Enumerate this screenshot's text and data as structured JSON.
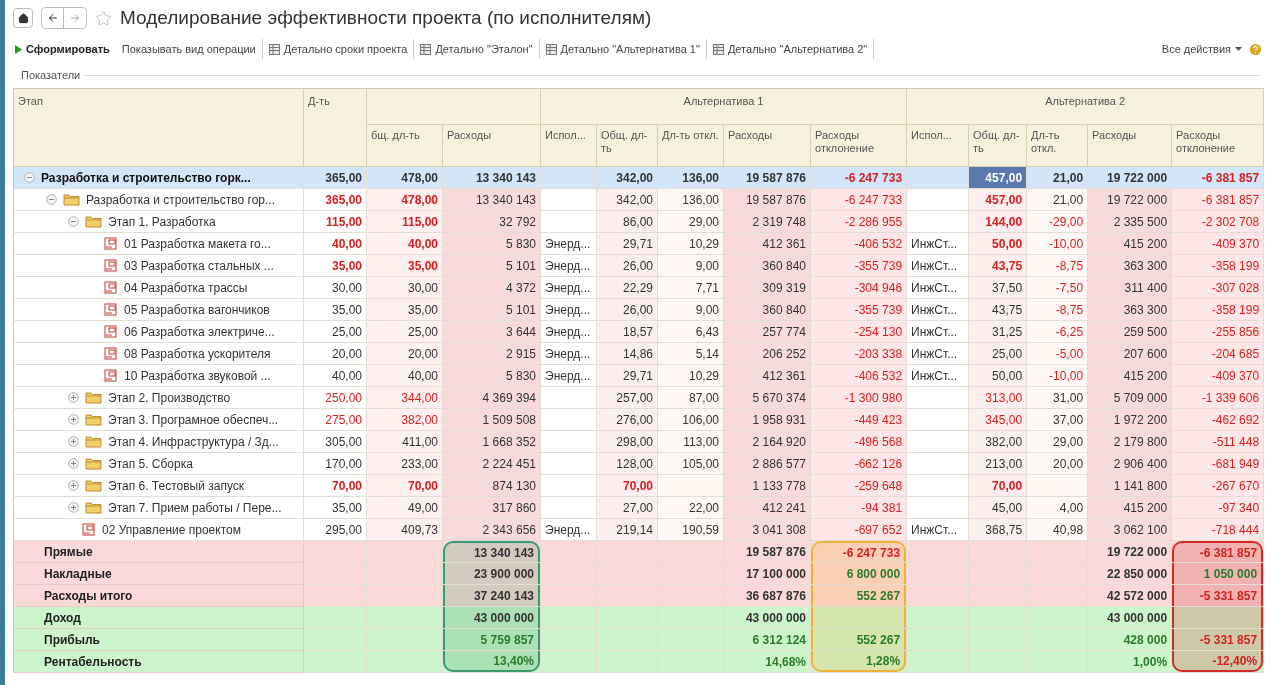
{
  "window": {
    "title": "Моделирование эффективности проекта (по исполнителям)"
  },
  "toolbar": [
    {
      "label": "Сформировать",
      "kind": "run"
    },
    {
      "label": "Показывать вид операции",
      "kind": "plain"
    },
    {
      "label": "Детально сроки проекта",
      "kind": "report"
    },
    {
      "label": "Детально \"Эталон\"",
      "kind": "report"
    },
    {
      "label": "Детально \"Альтернатива 1\"",
      "kind": "report"
    },
    {
      "label": "Детально \"Альтернатива 2\"",
      "kind": "report"
    },
    {
      "label": "Все действия",
      "kind": "menu"
    }
  ],
  "section": {
    "title": "Показатели"
  },
  "header": {
    "stage": "Этап",
    "duration": "Д-ть",
    "groups": [
      {
        "columns": [
          "бщ. дл-ть",
          "Расходы"
        ]
      },
      {
        "label": "Альтернатива 1",
        "columns": [
          "Испол...",
          "Общ. дл-ть",
          "Дл-ть откл.",
          "Расходы",
          "Расходы отклонение"
        ]
      },
      {
        "label": "Альтернатива 2",
        "columns": [
          "Испол...",
          "Общ. дл-ть",
          "Дл-ть откл.",
          "Расходы",
          "Расходы отклонение"
        ]
      }
    ]
  },
  "tree": [
    {
      "label": "Разработка и строительство горк...",
      "kind": "total",
      "expanded": true,
      "selected": true,
      "cells": [
        "365,00",
        "478,00",
        "13 340 143",
        null,
        "342,00",
        "136,00",
        "19 587 876",
        {
          "text": "-6 247 733",
          "red": true
        },
        null,
        {
          "text": "457,00",
          "current": true
        },
        "21,00",
        "19 722 000",
        {
          "text": "-6 381 857",
          "red": true
        }
      ],
      "children": [
        {
          "label": "Разработка и строительство гор...",
          "kind": "group",
          "expanded": true,
          "selected": false,
          "cells": [
            {
              "text": "365,00",
              "red": true,
              "bold": true
            },
            {
              "text": "478,00",
              "red": true,
              "bold": true
            },
            "13 340 143",
            null,
            "342,00",
            "136,00",
            "19 587 876",
            {
              "text": "-6 247 733",
              "red": true
            },
            null,
            {
              "text": "457,00",
              "red": true,
              "bold": true
            },
            "21,00",
            "19 722 000",
            {
              "text": "-6 381 857",
              "red": true
            }
          ],
          "children": [
            {
              "label": "Этап 1. Разработка",
              "kind": "group",
              "expanded": true,
              "selected": false,
              "cells": [
                {
                  "text": "115,00",
                  "red": true,
                  "bold": true
                },
                {
                  "text": "115,00",
                  "red": true,
                  "bold": true
                },
                "32 792",
                null,
                "86,00",
                "29,00",
                "2 319 748",
                {
                  "text": "-2 286 955",
                  "red": true
                },
                null,
                {
                  "text": "144,00",
                  "red": true,
                  "bold": true
                },
                {
                  "text": "-29,00",
                  "red": true
                },
                "2 335 500",
                {
                  "text": "-2 302 708",
                  "red": true
                }
              ],
              "children": [
                {
                  "label": "01 Разработка макета го...",
                  "kind": "task",
                  "selected": false,
                  "cells": [
                    {
                      "text": "40,00",
                      "red": true,
                      "bold": true
                    },
                    {
                      "text": "40,00",
                      "red": true,
                      "bold": true
                    },
                    "5 830",
                    "Энерд...",
                    "29,71",
                    "10,29",
                    "412 361",
                    {
                      "text": "-406 532",
                      "red": true
                    },
                    "ИнжСт...",
                    {
                      "text": "50,00",
                      "red": true,
                      "bold": true
                    },
                    {
                      "text": "-10,00",
                      "red": true
                    },
                    "415 200",
                    {
                      "text": "-409 370",
                      "red": true
                    }
                  ]
                },
                {
                  "label": "03 Разработка стальных ...",
                  "kind": "task",
                  "selected": false,
                  "cells": [
                    {
                      "text": "35,00",
                      "red": true,
                      "bold": true
                    },
                    {
                      "text": "35,00",
                      "red": true,
                      "bold": true
                    },
                    "5 101",
                    "Энерд...",
                    "26,00",
                    "9,00",
                    "360 840",
                    {
                      "text": "-355 739",
                      "red": true
                    },
                    "ИнжСт...",
                    {
                      "text": "43,75",
                      "red": true,
                      "bold": true
                    },
                    {
                      "text": "-8,75",
                      "red": true
                    },
                    "363 300",
                    {
                      "text": "-358 199",
                      "red": true
                    }
                  ]
                },
                {
                  "label": "04 Разработка трассы",
                  "kind": "task",
                  "selected": false,
                  "cells": [
                    "30,00",
                    "30,00",
                    "4 372",
                    "Энерд...",
                    "22,29",
                    "7,71",
                    "309 319",
                    {
                      "text": "-304 946",
                      "red": true
                    },
                    "ИнжСт...",
                    "37,50",
                    {
                      "text": "-7,50",
                      "red": true
                    },
                    "311 400",
                    {
                      "text": "-307 028",
                      "red": true
                    }
                  ]
                },
                {
                  "label": "05 Разработка вагончиков",
                  "kind": "task",
                  "selected": false,
                  "cells": [
                    "35,00",
                    "35,00",
                    "5 101",
                    "Энерд...",
                    "26,00",
                    "9,00",
                    "360 840",
                    {
                      "text": "-355 739",
                      "red": true
                    },
                    "ИнжСт...",
                    "43,75",
                    {
                      "text": "-8,75",
                      "red": true
                    },
                    "363 300",
                    {
                      "text": "-358 199",
                      "red": true
                    }
                  ]
                },
                {
                  "label": "06 Разработка электриче...",
                  "kind": "task",
                  "selected": false,
                  "cells": [
                    "25,00",
                    "25,00",
                    "3 644",
                    "Энерд...",
                    "18,57",
                    "6,43",
                    "257 774",
                    {
                      "text": "-254 130",
                      "red": true
                    },
                    "ИнжСт...",
                    "31,25",
                    {
                      "text": "-6,25",
                      "red": true
                    },
                    "259 500",
                    {
                      "text": "-255 856",
                      "red": true
                    }
                  ]
                },
                {
                  "label": "08 Разработка ускорителя",
                  "kind": "task",
                  "selected": false,
                  "cells": [
                    "20,00",
                    "20,00",
                    "2 915",
                    "Энерд...",
                    "14,86",
                    "5,14",
                    "206 252",
                    {
                      "text": "-203 338",
                      "red": true
                    },
                    "ИнжСт...",
                    "25,00",
                    {
                      "text": "-5,00",
                      "red": true
                    },
                    "207 600",
                    {
                      "text": "-204 685",
                      "red": true
                    }
                  ]
                },
                {
                  "label": "10 Разработка звуковой ...",
                  "kind": "task",
                  "selected": false,
                  "cells": [
                    "40,00",
                    "40,00",
                    "5 830",
                    "Энерд...",
                    "29,71",
                    "10,29",
                    "412 361",
                    {
                      "text": "-406 532",
                      "red": true
                    },
                    "ИнжСт...",
                    "50,00",
                    {
                      "text": "-10,00",
                      "red": true
                    },
                    "415 200",
                    {
                      "text": "-409 370",
                      "red": true
                    }
                  ]
                }
              ]
            },
            {
              "label": "Этап 2. Производство",
              "kind": "group",
              "expanded": false,
              "selected": false,
              "cells": [
                {
                  "text": "250,00",
                  "red": true
                },
                {
                  "text": "344,00",
                  "red": true
                },
                "4 369 394",
                null,
                "257,00",
                "87,00",
                "5 670 374",
                {
                  "text": "-1 300 980",
                  "red": true
                },
                null,
                {
                  "text": "313,00",
                  "red": true
                },
                "31,00",
                "5 709 000",
                {
                  "text": "-1 339 606",
                  "red": true
                }
              ]
            },
            {
              "label": "Этап 3. Програмное обеспеч...",
              "kind": "group",
              "expanded": false,
              "selected": false,
              "cells": [
                {
                  "text": "275,00",
                  "red": true
                },
                {
                  "text": "382,00",
                  "red": true
                },
                "1 509 508",
                null,
                "276,00",
                "106,00",
                "1 958 931",
                {
                  "text": "-449 423",
                  "red": true
                },
                null,
                {
                  "text": "345,00",
                  "red": true
                },
                "37,00",
                "1 972 200",
                {
                  "text": "-462 692",
                  "red": true
                }
              ]
            },
            {
              "label": "Этап 4. Инфраструктура / Зд...",
              "kind": "group",
              "expanded": false,
              "selected": false,
              "cells": [
                "305,00",
                "411,00",
                "1 668 352",
                null,
                "298,00",
                "113,00",
                "2 164 920",
                {
                  "text": "-496 568",
                  "red": true
                },
                null,
                "382,00",
                "29,00",
                "2 179 800",
                {
                  "text": "-511 448",
                  "red": true
                }
              ]
            },
            {
              "label": "Этап 5. Сборка",
              "kind": "group",
              "expanded": false,
              "selected": false,
              "cells": [
                "170,00",
                "233,00",
                "2 224 451",
                null,
                "128,00",
                "105,00",
                "2 886 577",
                {
                  "text": "-662 126",
                  "red": true
                },
                null,
                "213,00",
                "20,00",
                "2 906 400",
                {
                  "text": "-681 949",
                  "red": true
                }
              ]
            },
            {
              "label": "Этап 6. Тестовый запуск",
              "kind": "group",
              "expanded": false,
              "selected": false,
              "cells": [
                {
                  "text": "70,00",
                  "red": true,
                  "bold": true
                },
                {
                  "text": "70,00",
                  "red": true,
                  "bold": true
                },
                "874 130",
                null,
                {
                  "text": "70,00",
                  "red": true,
                  "bold": true
                },
                null,
                "1 133 778",
                {
                  "text": "-259 648",
                  "red": true
                },
                null,
                {
                  "text": "70,00",
                  "red": true,
                  "bold": true
                },
                null,
                "1 141 800",
                {
                  "text": "-267 670",
                  "red": true
                }
              ]
            },
            {
              "label": "Этап 7. Прием работы / Пере...",
              "kind": "group",
              "expanded": false,
              "selected": false,
              "cells": [
                "35,00",
                "49,00",
                "317 860",
                null,
                "27,00",
                "22,00",
                "412 241",
                {
                  "text": "-94 381",
                  "red": true
                },
                null,
                "45,00",
                "4,00",
                "415 200",
                {
                  "text": "-97 340",
                  "red": true
                }
              ]
            },
            {
              "label": "02 Управление проектом",
              "kind": "task",
              "selected": false,
              "cells": [
                "295,00",
                "409,73",
                "2 343 656",
                "Энерд...",
                "219,14",
                "190,59",
                "3 041 308",
                {
                  "text": "-697 652",
                  "red": true
                },
                "ИнжСт...",
                "368,75",
                "40,98",
                "3 062 100",
                {
                  "text": "-718 444",
                  "red": true
                }
              ]
            }
          ]
        }
      ]
    }
  ],
  "summary": [
    {
      "label": "Прямые",
      "kind": "cost",
      "cells": [
        null,
        null,
        {
          "text": "13 340 143",
          "color": "#3a9a6a"
        },
        null,
        null,
        null,
        "19 587 876",
        {
          "text": "-6 247 733",
          "red": true,
          "color": "#f2b23a"
        },
        null,
        null,
        null,
        "19 722 000",
        {
          "text": "-6 381 857",
          "red": true,
          "color": "#d32a2a"
        }
      ]
    },
    {
      "label": "Накладные",
      "kind": "cost",
      "cells": [
        null,
        null,
        {
          "text": "23 900 000",
          "color": "#3a9a6a"
        },
        null,
        null,
        null,
        "17 100 000",
        {
          "text": "6 800 000",
          "green": true,
          "color": "#f2b23a"
        },
        null,
        null,
        null,
        "22 850 000",
        {
          "text": "1 050 000",
          "green": true,
          "color": "#d32a2a"
        }
      ]
    },
    {
      "label": "Расходы итого",
      "kind": "cost",
      "cells": [
        null,
        null,
        {
          "text": "37 240 143",
          "color": "#3a9a6a"
        },
        null,
        null,
        null,
        "36 687 876",
        {
          "text": "552 267",
          "green": true,
          "color": "#f2b23a"
        },
        null,
        null,
        null,
        "42 572 000",
        {
          "text": "-5 331 857",
          "red": true,
          "color": "#d32a2a"
        }
      ]
    },
    {
      "label": "Доход",
      "kind": "income",
      "cells": [
        null,
        null,
        {
          "text": "43 000 000",
          "color": "#3a9a6a"
        },
        null,
        null,
        null,
        "43 000 000",
        {
          "color": "#f2b23a"
        },
        null,
        null,
        null,
        "43 000 000",
        {
          "color": "#d32a2a"
        }
      ]
    },
    {
      "label": "Прибыль",
      "kind": "income",
      "cells": [
        null,
        null,
        {
          "text": "5 759 857",
          "green": true,
          "color": "#3a9a6a"
        },
        null,
        null,
        null,
        {
          "text": "6 312 124",
          "green": true
        },
        {
          "text": "552 267",
          "green": true,
          "color": "#f2b23a"
        },
        null,
        null,
        null,
        {
          "text": "428 000",
          "green": true
        },
        {
          "text": "-5 331 857",
          "red": true,
          "color": "#d32a2a"
        }
      ]
    },
    {
      "label": "Рентабельность",
      "kind": "income",
      "cells": [
        null,
        null,
        {
          "text": "13,40%",
          "green": true,
          "color": "#3a9a6a"
        },
        null,
        null,
        null,
        {
          "text": "14,68%",
          "green": true
        },
        {
          "text": "1,28%",
          "green": true,
          "color": "#f2b23a"
        },
        null,
        null,
        null,
        {
          "text": "1,00%",
          "green": true
        },
        {
          "text": "-12,40%",
          "red": true,
          "color": "#d32a2a"
        }
      ]
    }
  ]
}
